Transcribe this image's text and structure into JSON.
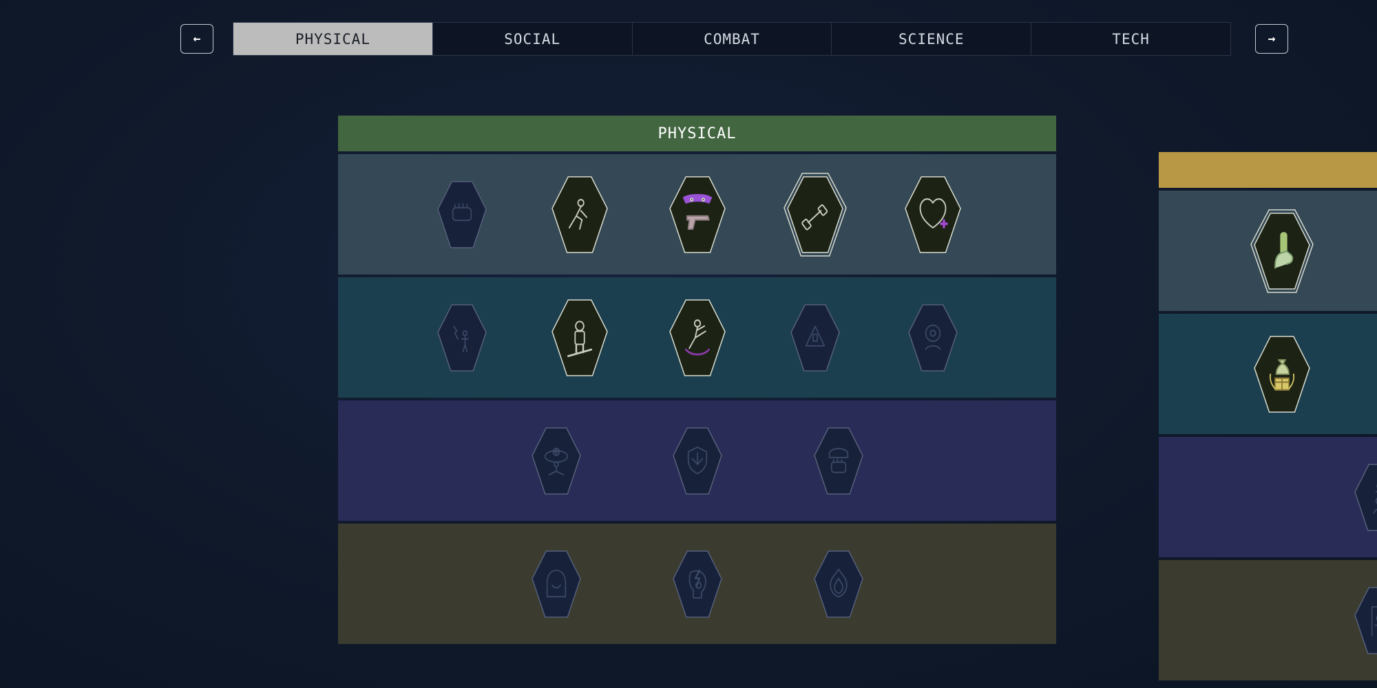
{
  "nav": {
    "prev_icon": "arrow-left-icon",
    "next_icon": "arrow-right-icon",
    "prev_glyph": "←",
    "next_glyph": "→"
  },
  "tabs": [
    {
      "label": "PHYSICAL",
      "active": true
    },
    {
      "label": "SOCIAL",
      "active": false
    },
    {
      "label": "COMBAT",
      "active": false
    },
    {
      "label": "SCIENCE",
      "active": false
    },
    {
      "label": "TECH",
      "active": false
    }
  ],
  "physical_panel": {
    "title": "PHYSICAL",
    "header_color": "#426640",
    "tiers": [
      {
        "color": "#344855",
        "skills": [
          {
            "icon": "fist-icon",
            "unlocked": false
          },
          {
            "icon": "crouching-figure-icon",
            "unlocked": true
          },
          {
            "icon": "masked-pistol-icon",
            "unlocked": true
          },
          {
            "icon": "dumbbell-icon",
            "unlocked": true,
            "ranked": true
          },
          {
            "icon": "heart-plus-icon",
            "unlocked": true
          }
        ]
      },
      {
        "color": "#1b3f4e",
        "skills": [
          {
            "icon": "energy-figure-icon",
            "unlocked": false
          },
          {
            "icon": "astronaut-icon",
            "unlocked": true
          },
          {
            "icon": "kick-icon",
            "unlocked": true
          },
          {
            "icon": "hazard-icon",
            "unlocked": false
          },
          {
            "icon": "eye-figure-icon",
            "unlocked": false
          }
        ]
      },
      {
        "color": "#2a2c58",
        "skills": [
          {
            "icon": "meditation-icon",
            "unlocked": false
          },
          {
            "icon": "shield-emblem-icon",
            "unlocked": false
          },
          {
            "icon": "helmet-fist-icon",
            "unlocked": false
          }
        ]
      },
      {
        "color": "#3b3c2f",
        "skills": [
          {
            "icon": "hooded-figure-icon",
            "unlocked": false
          },
          {
            "icon": "lightning-head-icon",
            "unlocked": false
          },
          {
            "icon": "flame-emblem-icon",
            "unlocked": false
          }
        ]
      }
    ]
  },
  "social_panel": {
    "header_color": "#b89844",
    "tiers": [
      {
        "color": "#344855",
        "skills": [
          {
            "icon": "hand-card-icon",
            "unlocked": true,
            "ranked": true
          }
        ]
      },
      {
        "color": "#1b3f4e",
        "skills": [
          {
            "icon": "money-gift-icon",
            "unlocked": true
          }
        ]
      },
      {
        "color": "#2a2c58",
        "skills": [
          {
            "icon": "figures-icon",
            "unlocked": false
          }
        ]
      },
      {
        "color": "#3b3c2f",
        "skills": [
          {
            "icon": "puppet-icon",
            "unlocked": false
          }
        ]
      }
    ]
  }
}
